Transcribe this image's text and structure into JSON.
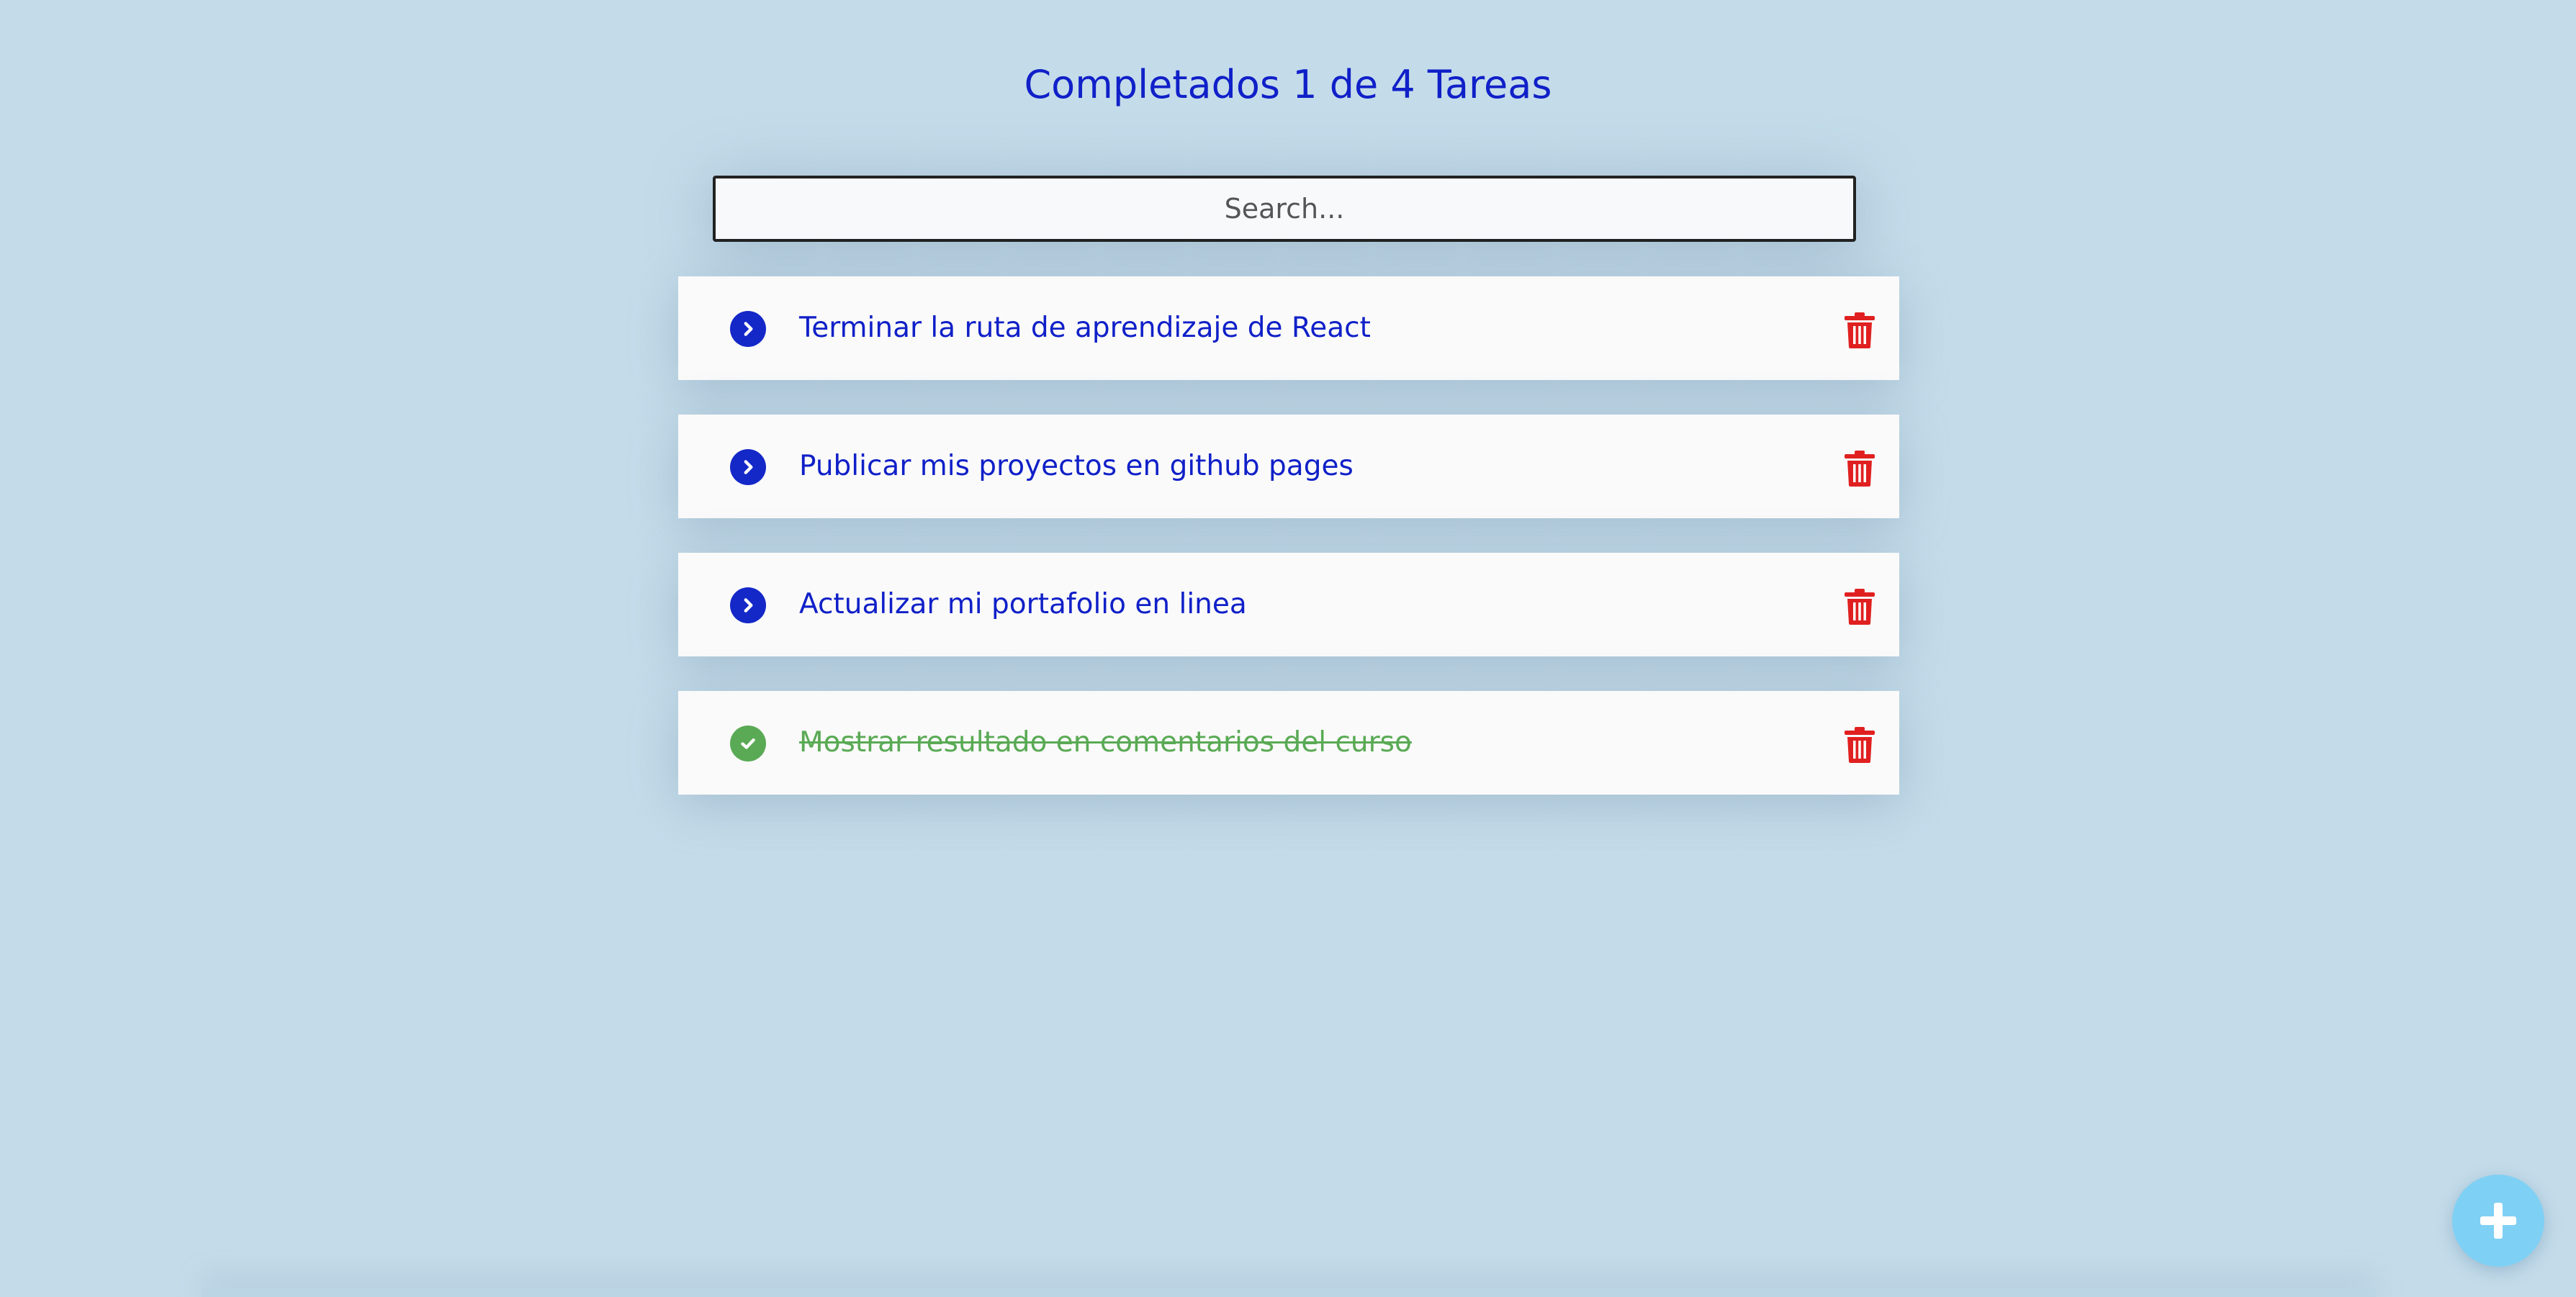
{
  "header": {
    "title": "Completados 1 de 4 Tareas"
  },
  "search": {
    "placeholder": "Search...",
    "value": ""
  },
  "todos": [
    {
      "text": "Terminar la ruta de aprendizaje de React",
      "completed": false,
      "check_icon": "chevron-right-circle-icon",
      "delete_icon": "trash-icon"
    },
    {
      "text": "Publicar mis proyectos en github pages",
      "completed": false,
      "check_icon": "chevron-right-circle-icon",
      "delete_icon": "trash-icon"
    },
    {
      "text": "Actualizar mi portafolio en linea",
      "completed": false,
      "check_icon": "chevron-right-circle-icon",
      "delete_icon": "trash-icon"
    },
    {
      "text": "Mostrar resultado en comentarios del curso",
      "completed": true,
      "check_icon": "check-circle-icon",
      "delete_icon": "trash-icon"
    }
  ],
  "fab": {
    "icon": "plus-icon"
  },
  "colors": {
    "background": "#c4dcea",
    "accent": "#1020c8",
    "completed": "#5aaa55",
    "delete": "#e02020",
    "fab": "#7fd0f5",
    "card": "#fafafa"
  }
}
